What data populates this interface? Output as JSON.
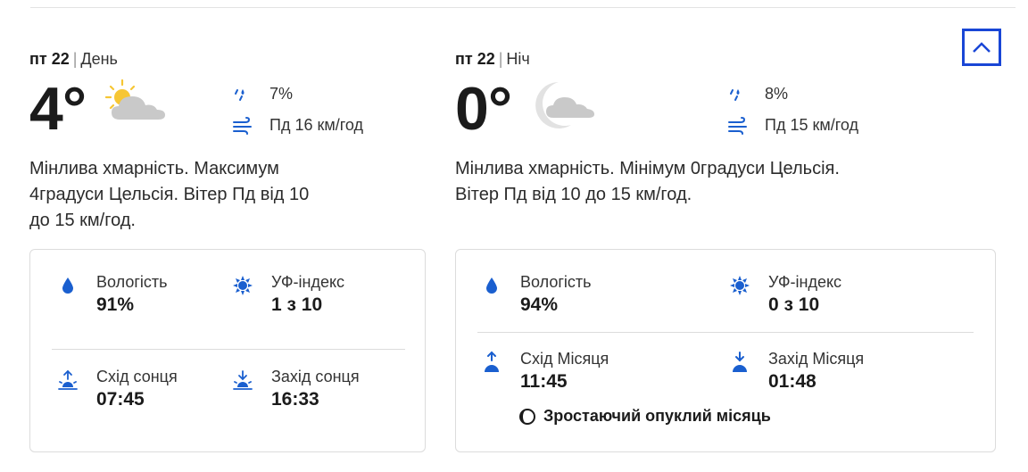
{
  "day": {
    "date": "пт 22",
    "period": "День",
    "temperature": "4°",
    "icon": "partly-cloudy-day-icon",
    "precip_chance": "7%",
    "wind": "Пд 16 км/год",
    "description_lines": [
      "Мінлива хмарність. Максимум",
      "4градуси Цельсія. Вітер Пд від 10",
      "до 15 км/год."
    ],
    "humidity_label": "Вологість",
    "humidity_value": "91%",
    "uv_label": "УФ-індекс",
    "uv_value": "1 з 10",
    "rise_label": "Схід сонця",
    "rise_value": "07:45",
    "set_label": "Захід сонця",
    "set_value": "16:33"
  },
  "night": {
    "date": "пт 22",
    "period": "Ніч",
    "temperature": "0°",
    "icon": "partly-cloudy-night-icon",
    "precip_chance": "8%",
    "wind": "Пд 15 км/год",
    "description_lines": [
      "Мінлива хмарність. Мінімум 0градуси Цельсія.",
      "Вітер Пд від 10 до 15 км/год."
    ],
    "humidity_label": "Вологість",
    "humidity_value": "94%",
    "uv_label": "УФ-індекс",
    "uv_value": "0 з 10",
    "rise_label": "Схід Місяця",
    "rise_value": "11:45",
    "set_label": "Захід Місяця",
    "set_value": "01:48",
    "moon_phase": "Зростаючий опуклий місяць"
  },
  "colors": {
    "accent": "#1946d6",
    "icon_blue": "#1a5fcf",
    "sun": "#f6c634",
    "cloud": "#c9c9c9"
  }
}
